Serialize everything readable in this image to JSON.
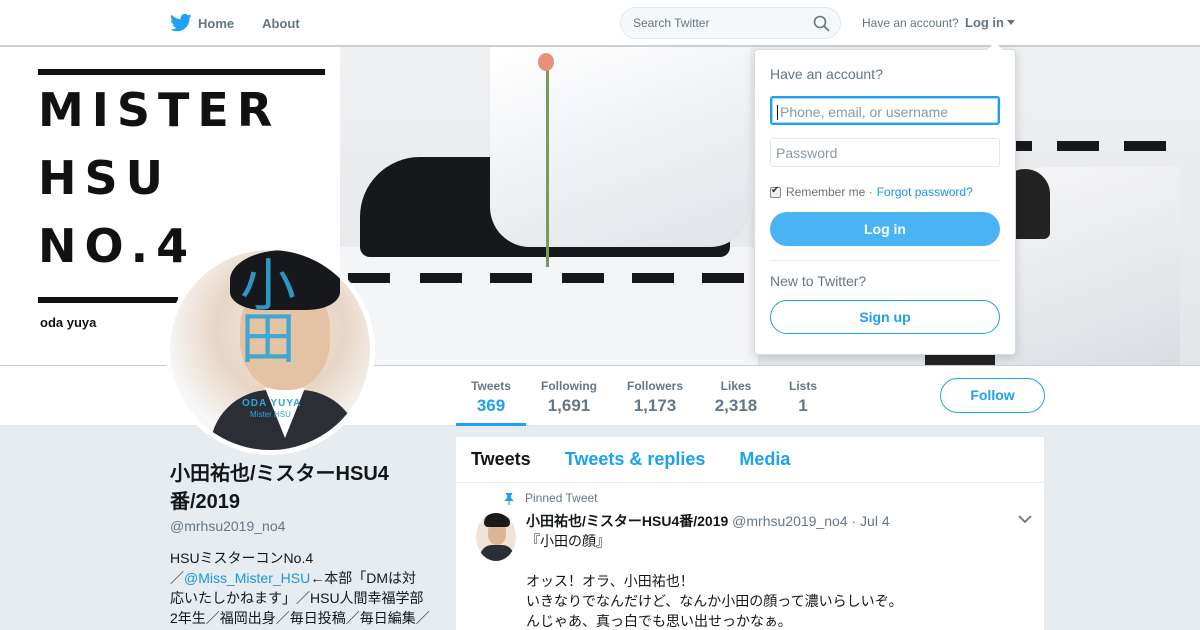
{
  "nav": {
    "home": "Home",
    "about": "About",
    "search_placeholder": "Search Twitter",
    "have_account": "Have an account?",
    "login": "Log in"
  },
  "banner": {
    "line1": "MISTER",
    "line2": "HSU",
    "line3": "NO.4",
    "caption": "oda yuya"
  },
  "avatar": {
    "kanji1": "小",
    "kanji2": "田",
    "caption": "ODA YUYA",
    "caption2": "Mister HSU"
  },
  "stats": [
    {
      "label": "Tweets",
      "value": "369"
    },
    {
      "label": "Following",
      "value": "1,691"
    },
    {
      "label": "Followers",
      "value": "1,173"
    },
    {
      "label": "Likes",
      "value": "2,318"
    },
    {
      "label": "Lists",
      "value": "1"
    }
  ],
  "follow_button": "Follow",
  "profile": {
    "name": "小田祐也/ミスターHSU4番/2019",
    "handle": "@mrhsu2019_no4",
    "bio_line1": "HSUミスターコンNo.4",
    "bio_prefix": "／",
    "bio_mention": "@Miss_Mister_HSU",
    "bio_rest1": "←本部「DMは対",
    "bio_line3": "応いたしかねます」／HSU人間幸福学部",
    "bio_line4": "2年生／福岡出身／毎日投稿／毎日編集／"
  },
  "timeline": {
    "tabs": [
      "Tweets",
      "Tweets & replies",
      "Media"
    ],
    "pinned_label": "Pinned Tweet",
    "tweet": {
      "name": "小田祐也/ミスターHSU4番/2019",
      "handle": "@mrhsu2019_no4",
      "date": "Jul 4",
      "body": "『小田の顔』\n\nオッス！オラ、小田祐也！\nいきなりでなんだけど、なんか小田の顔って濃いらしいぞ。\nんじゃあ、真っ白でも思い出せっかなぁ。"
    }
  },
  "login_dropdown": {
    "title": "Have an account?",
    "username_placeholder": "Phone, email, or username",
    "password_placeholder": "Password",
    "remember": "Remember me",
    "forgot": "Forgot password?",
    "login_button": "Log in",
    "new_to": "New to Twitter?",
    "signup_button": "Sign up"
  },
  "colors": {
    "accent": "#1da1f2",
    "login_button": "#4ab3f4",
    "background": "#e6ecf0"
  },
  "icons": [
    "twitter-bird-icon",
    "search-icon",
    "caret-down-icon",
    "pin-icon",
    "chevron-down-icon",
    "checkbox-icon"
  ]
}
